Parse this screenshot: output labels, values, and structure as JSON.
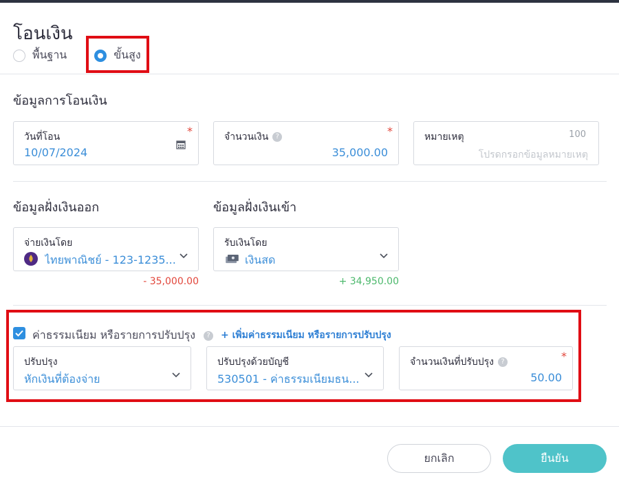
{
  "dialog": {
    "title": "โอนเงิน",
    "mode_options": [
      {
        "label": "พื้นฐาน",
        "selected": false
      },
      {
        "label": "ขั้นสูง",
        "selected": true
      }
    ]
  },
  "transfer_info": {
    "section_title": "ข้อมูลการโอนเงิน",
    "date": {
      "label": "วันที่โอน",
      "value": "10/07/2024",
      "required": "*"
    },
    "amount": {
      "label": "จำนวนเงิน",
      "value": "35,000.00",
      "required": "*"
    },
    "note": {
      "label": "หมายเหตุ",
      "counter": "100",
      "placeholder": "โปรดกรอกข้อมูลหมายเหตุ"
    }
  },
  "outgoing": {
    "section_title": "ข้อมูลฝั่งเงินออก",
    "label": "จ่ายเงินโดย",
    "value": "ไทยพาณิชย์ - 123-1235...",
    "amount": "- 35,000.00"
  },
  "incoming": {
    "section_title": "ข้อมูลฝั่งเงินเข้า",
    "label": "รับเงินโดย",
    "value": "เงินสด",
    "amount": "+ 34,950.00"
  },
  "adjustment": {
    "checkbox_label": "ค่าธรรมเนียม หรือรายการปรับปรุง",
    "add_link": "+ เพิ่มค่าธรรมเนียม หรือรายการปรับปรุง",
    "type": {
      "label": "ปรับปรุง",
      "value": "หักเงินที่ต้องจ่าย"
    },
    "account": {
      "label": "ปรับปรุงด้วยบัญชี",
      "value": "530501 - ค่าธรรมเนียมธน..."
    },
    "amount": {
      "label": "จำนวนเงินที่ปรับปรุง",
      "value": "50.00",
      "required": "*"
    }
  },
  "footer": {
    "cancel_label": "ยกเลิก",
    "confirm_label": "ยืนยัน"
  },
  "colors": {
    "accent": "#2e8fe0",
    "value_text": "#3b8ed8",
    "negative": "#e2463b",
    "positive": "#4cb86c",
    "confirm_button": "#4fc3c9",
    "highlight_box": "#e00d14"
  },
  "icons": [
    "calendar-icon",
    "help-icon",
    "chevron-down-icon",
    "scb-bank-icon",
    "cash-icon",
    "checkbox-checked-icon"
  ]
}
